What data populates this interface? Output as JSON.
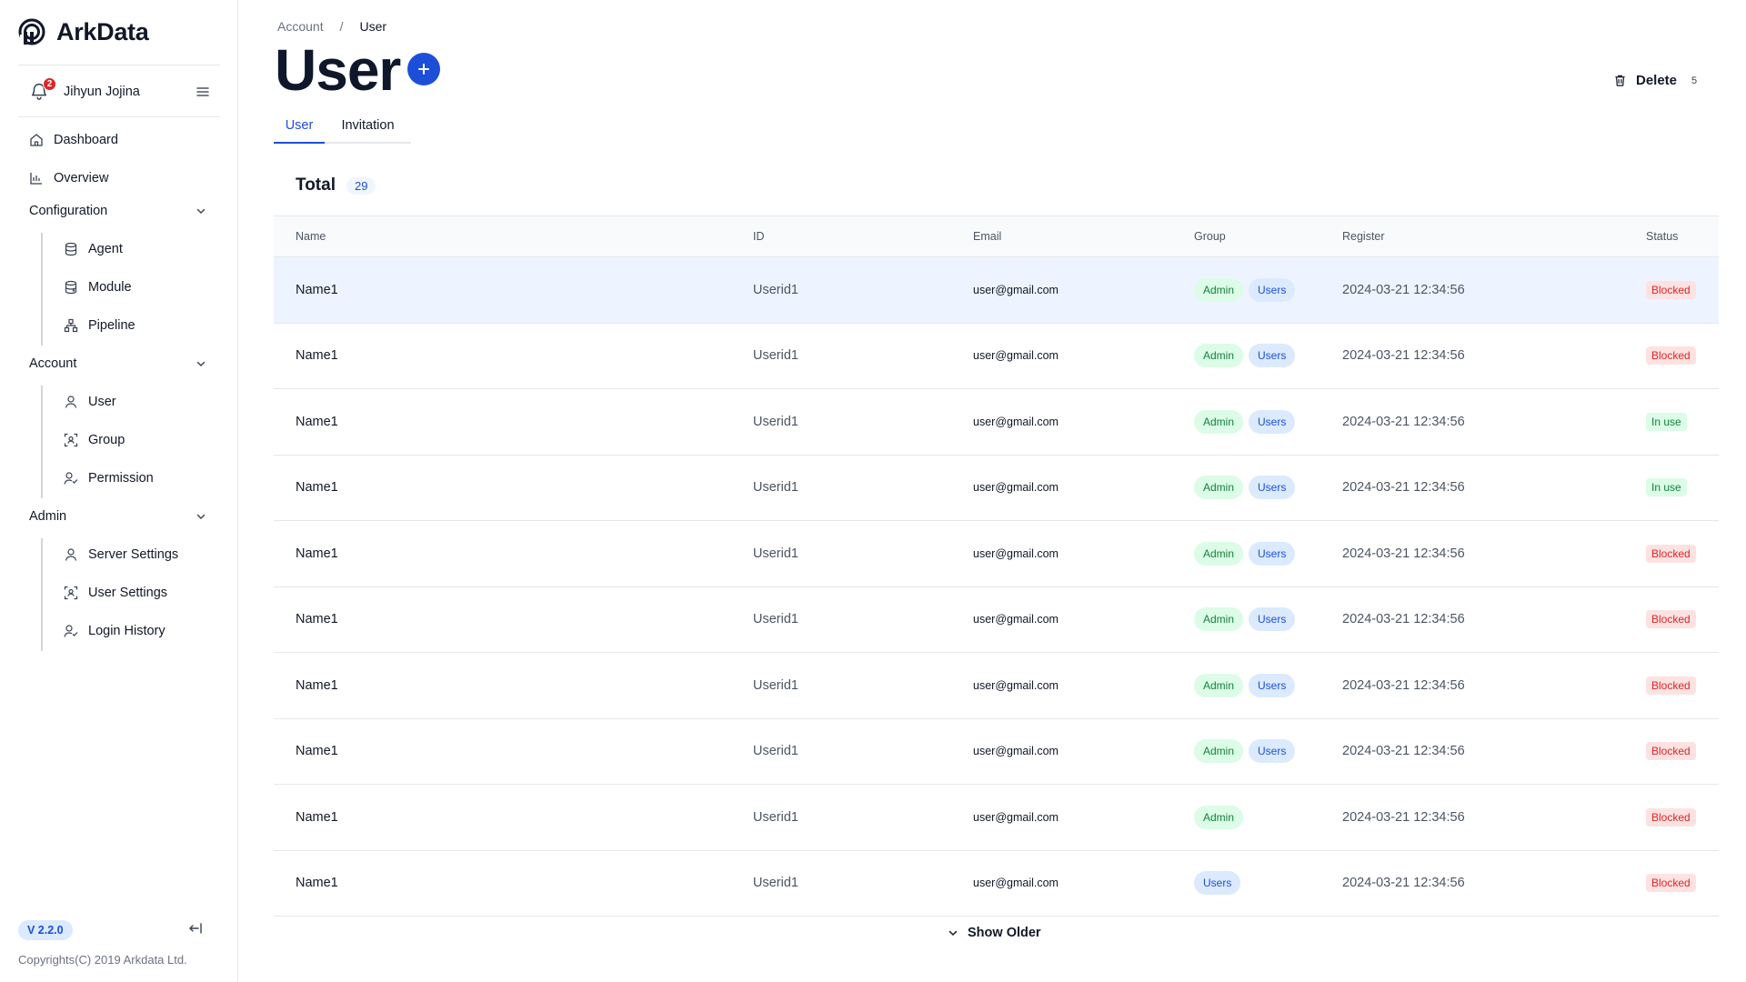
{
  "brand": {
    "name": "ArkData",
    "logo_icon": "arkdata-logo-icon"
  },
  "user": {
    "name": "Jihyun Jojina",
    "notification_count": "2"
  },
  "nav": {
    "dashboard": "Dashboard",
    "overview": "Overview",
    "configuration": {
      "label": "Configuration",
      "items": [
        "Agent",
        "Module",
        "Pipeline"
      ]
    },
    "account": {
      "label": "Account",
      "items": [
        "User",
        "Group",
        "Permission"
      ]
    },
    "admin": {
      "label": "Admin",
      "items": [
        "Server Settings",
        "User Settings",
        "Login History"
      ]
    }
  },
  "footer": {
    "version": "V 2.2.0",
    "copyright": "Copyrights(C) 2019 Arkdata Ltd."
  },
  "breadcrumb": {
    "parent": "Account",
    "separator": "/",
    "current": "User"
  },
  "page": {
    "title": "User"
  },
  "toolbar": {
    "delete_label": "Delete",
    "delete_count": "5"
  },
  "tabs": [
    "User",
    "Invitation"
  ],
  "total": {
    "label": "Total",
    "count": "29"
  },
  "table": {
    "columns": [
      "Name",
      "ID",
      "Email",
      "Group",
      "Register",
      "Status"
    ],
    "rows": [
      {
        "name": "Name1",
        "id": "Userid1",
        "email": "user@gmail.com",
        "groups": [
          "Admin",
          "Users"
        ],
        "register": "2024-03-21 12:34:56",
        "status": "Blocked"
      },
      {
        "name": "Name1",
        "id": "Userid1",
        "email": "user@gmail.com",
        "groups": [
          "Admin",
          "Users"
        ],
        "register": "2024-03-21 12:34:56",
        "status": "Blocked"
      },
      {
        "name": "Name1",
        "id": "Userid1",
        "email": "user@gmail.com",
        "groups": [
          "Admin",
          "Users"
        ],
        "register": "2024-03-21 12:34:56",
        "status": "In use"
      },
      {
        "name": "Name1",
        "id": "Userid1",
        "email": "user@gmail.com",
        "groups": [
          "Admin",
          "Users"
        ],
        "register": "2024-03-21 12:34:56",
        "status": "In use"
      },
      {
        "name": "Name1",
        "id": "Userid1",
        "email": "user@gmail.com",
        "groups": [
          "Admin",
          "Users"
        ],
        "register": "2024-03-21 12:34:56",
        "status": "Blocked"
      },
      {
        "name": "Name1",
        "id": "Userid1",
        "email": "user@gmail.com",
        "groups": [
          "Admin",
          "Users"
        ],
        "register": "2024-03-21 12:34:56",
        "status": "Blocked"
      },
      {
        "name": "Name1",
        "id": "Userid1",
        "email": "user@gmail.com",
        "groups": [
          "Admin",
          "Users"
        ],
        "register": "2024-03-21 12:34:56",
        "status": "Blocked"
      },
      {
        "name": "Name1",
        "id": "Userid1",
        "email": "user@gmail.com",
        "groups": [
          "Admin",
          "Users"
        ],
        "register": "2024-03-21 12:34:56",
        "status": "Blocked"
      },
      {
        "name": "Name1",
        "id": "Userid1",
        "email": "user@gmail.com",
        "groups": [
          "Admin"
        ],
        "register": "2024-03-21 12:34:56",
        "status": "Blocked"
      },
      {
        "name": "Name1",
        "id": "Userid1",
        "email": "user@gmail.com",
        "groups": [
          "Users"
        ],
        "register": "2024-03-21 12:34:56",
        "status": "Blocked"
      }
    ]
  },
  "show_older": "Show Older",
  "colors": {
    "accent": "#1d4ed8",
    "admin_pill": "#dcfce7",
    "users_pill": "#dbeafe",
    "blocked": "#dc2626",
    "in_use": "#15803d"
  }
}
